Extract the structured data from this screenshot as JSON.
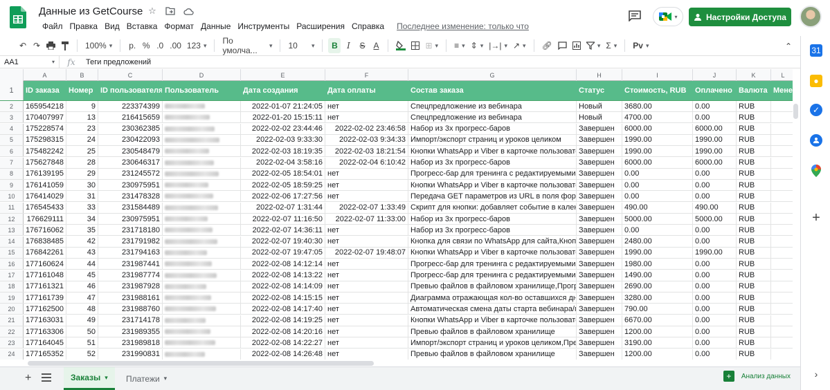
{
  "doc": {
    "title": "Данные из GetCourse",
    "last_edit": "Последнее изменение: только что"
  },
  "menu": [
    "Файл",
    "Правка",
    "Вид",
    "Вставка",
    "Формат",
    "Данные",
    "Инструменты",
    "Расширения",
    "Справка"
  ],
  "share_label": "Настройки Доступа",
  "toolbar": {
    "zoom": "100%",
    "currency": "р.",
    "percent": "%",
    "dec_less": ".0",
    "dec_more": ".00",
    "number_format": "123",
    "font": "По умолча...",
    "font_size": "10"
  },
  "formula": {
    "cell_ref": "AA1",
    "value": "Теги предложений"
  },
  "columns": [
    "A",
    "B",
    "C",
    "D",
    "E",
    "F",
    "G",
    "H",
    "I",
    "J",
    "K",
    "L"
  ],
  "headers": [
    "ID заказа",
    "Номер",
    "ID пользователя",
    "Пользователь",
    "Дата создания",
    "Дата оплаты",
    "Состав заказа",
    "Статус",
    "Стоимость, RUB",
    "Оплачено",
    "Валюта",
    "Менеджер"
  ],
  "rows": [
    {
      "n": "2",
      "id": "165954218",
      "num": "9",
      "uid": "223374399",
      "created": "2022-01-07 21:24:05",
      "paid": "нет",
      "comp": "Спецпредложение из вебинара",
      "status": "Новый",
      "cost": "3680.00",
      "paid_sum": "0.00",
      "cur": "RUB"
    },
    {
      "n": "3",
      "id": "170407997",
      "num": "13",
      "uid": "216415659",
      "created": "2022-01-20 15:15:11",
      "paid": "нет",
      "comp": "Спецпредложение из вебинара",
      "status": "Новый",
      "cost": "4700.00",
      "paid_sum": "0.00",
      "cur": "RUB"
    },
    {
      "n": "4",
      "id": "175228574",
      "num": "23",
      "uid": "230362385",
      "created": "2022-02-02 23:44:46",
      "paid": "2022-02-02 23:46:58",
      "comp": "Набор из 3х прогресс-баров",
      "status": "Завершен",
      "cost": "6000.00",
      "paid_sum": "6000.00",
      "cur": "RUB"
    },
    {
      "n": "5",
      "id": "175298315",
      "num": "24",
      "uid": "230422093",
      "created": "2022-02-03 9:33:30",
      "paid": "2022-02-03 9:34:33",
      "comp": "Импорт/экспорт страниц и уроков целиком",
      "status": "Завершен",
      "cost": "1990.00",
      "paid_sum": "1990.00",
      "cur": "RUB"
    },
    {
      "n": "6",
      "id": "175482242",
      "num": "25",
      "uid": "230548479",
      "created": "2022-02-03 18:19:35",
      "paid": "2022-02-03 18:21:54",
      "comp": "Кнопки WhatsApp и Viber в карточке пользователя",
      "status": "Завершен",
      "cost": "1990.00",
      "paid_sum": "1990.00",
      "cur": "RUB"
    },
    {
      "n": "7",
      "id": "175627848",
      "num": "28",
      "uid": "230646317",
      "created": "2022-02-04 3:58:16",
      "paid": "2022-02-04 6:10:42",
      "comp": "Набор из 3х прогресс-баров",
      "status": "Завершен",
      "cost": "6000.00",
      "paid_sum": "6000.00",
      "cur": "RUB"
    },
    {
      "n": "8",
      "id": "176139195",
      "num": "29",
      "uid": "231245572",
      "created": "2022-02-05 18:54:01",
      "paid": "нет",
      "comp": "Прогресс-бар для тренинга с редактируемыми эта",
      "status": "Завершен",
      "cost": "0.00",
      "paid_sum": "0.00",
      "cur": "RUB"
    },
    {
      "n": "9",
      "id": "176141059",
      "num": "30",
      "uid": "230975951",
      "created": "2022-02-05 18:59:25",
      "paid": "нет",
      "comp": "Кнопки WhatsApp и Viber в карточке пользователя",
      "status": "Завершен",
      "cost": "0.00",
      "paid_sum": "0.00",
      "cur": "RUB"
    },
    {
      "n": "10",
      "id": "176414029",
      "num": "31",
      "uid": "231478328",
      "created": "2022-02-06 17:27:56",
      "paid": "нет",
      "comp": "Передача GET параметров из URL в поля формы",
      "status": "Завершен",
      "cost": "0.00",
      "paid_sum": "0.00",
      "cur": "RUB"
    },
    {
      "n": "11",
      "id": "176545433",
      "num": "33",
      "uid": "231584489",
      "created": "2022-02-07 1:31:44",
      "paid": "2022-02-07 1:33:49",
      "comp": "Скрипт для кнопки: добавляет событие в календа",
      "status": "Завершен",
      "cost": "490.00",
      "paid_sum": "490.00",
      "cur": "RUB"
    },
    {
      "n": "12",
      "id": "176629111",
      "num": "34",
      "uid": "230975951",
      "created": "2022-02-07 11:16:50",
      "paid": "2022-02-07 11:33:00",
      "comp": "Набор из 3х прогресс-баров",
      "status": "Завершен",
      "cost": "5000.00",
      "paid_sum": "5000.00",
      "cur": "RUB"
    },
    {
      "n": "13",
      "id": "176716062",
      "num": "35",
      "uid": "231718180",
      "created": "2022-02-07 14:36:11",
      "paid": "нет",
      "comp": "Набор из 3х прогресс-баров",
      "status": "Завершен",
      "cost": "0.00",
      "paid_sum": "0.00",
      "cur": "RUB"
    },
    {
      "n": "14",
      "id": "176838485",
      "num": "42",
      "uid": "231791982",
      "created": "2022-02-07 19:40:30",
      "paid": "нет",
      "comp": "Кнопка для связи по WhatsApp для сайта,Кнопки W",
      "status": "Завершен",
      "cost": "2480.00",
      "paid_sum": "0.00",
      "cur": "RUB"
    },
    {
      "n": "15",
      "id": "176842261",
      "num": "43",
      "uid": "231794163",
      "created": "2022-02-07 19:47:05",
      "paid": "2022-02-07 19:48:07",
      "comp": "Кнопки WhatsApp и Viber в карточке пользователя",
      "status": "Завершен",
      "cost": "1990.00",
      "paid_sum": "1990.00",
      "cur": "RUB"
    },
    {
      "n": "16",
      "id": "177160624",
      "num": "44",
      "uid": "231987441",
      "created": "2022-02-08 14:12:14",
      "paid": "нет",
      "comp": "Прогресс-бар для тренинга с редактируемыми эта",
      "status": "Завершен",
      "cost": "1980.00",
      "paid_sum": "0.00",
      "cur": "RUB"
    },
    {
      "n": "17",
      "id": "177161048",
      "num": "45",
      "uid": "231987774",
      "created": "2022-02-08 14:13:22",
      "paid": "нет",
      "comp": "Прогресс-бар для тренинга с редактируемыми эта",
      "status": "Завершен",
      "cost": "1490.00",
      "paid_sum": "0.00",
      "cur": "RUB"
    },
    {
      "n": "18",
      "id": "177161321",
      "num": "46",
      "uid": "231987928",
      "created": "2022-02-08 14:14:09",
      "paid": "нет",
      "comp": "Превью файлов в файловом хранилище,Прогресс",
      "status": "Завершен",
      "cost": "2690.00",
      "paid_sum": "0.00",
      "cur": "RUB"
    },
    {
      "n": "19",
      "id": "177161739",
      "num": "47",
      "uid": "231988161",
      "created": "2022-02-08 14:15:15",
      "paid": "нет",
      "comp": "Диаграмма отражающая кол-во оставшихся дней",
      "status": "Завершен",
      "cost": "3280.00",
      "paid_sum": "0.00",
      "cur": "RUB"
    },
    {
      "n": "20",
      "id": "177162500",
      "num": "48",
      "uid": "231988760",
      "created": "2022-02-08 14:17:40",
      "paid": "нет",
      "comp": "Автоматическая смена даты старта вебинара/пото",
      "status": "Завершен",
      "cost": "790.00",
      "paid_sum": "0.00",
      "cur": "RUB"
    },
    {
      "n": "21",
      "id": "177163031",
      "num": "49",
      "uid": "231714178",
      "created": "2022-02-08 14:19:25",
      "paid": "нет",
      "comp": "Кнопки WhatsApp и Viber в карточке пользователя",
      "status": "Завершен",
      "cost": "6670.00",
      "paid_sum": "0.00",
      "cur": "RUB"
    },
    {
      "n": "22",
      "id": "177163306",
      "num": "50",
      "uid": "231989355",
      "created": "2022-02-08 14:20:16",
      "paid": "нет",
      "comp": "Превью файлов в файловом хранилище",
      "status": "Завершен",
      "cost": "1200.00",
      "paid_sum": "0.00",
      "cur": "RUB"
    },
    {
      "n": "23",
      "id": "177164045",
      "num": "51",
      "uid": "231989818",
      "created": "2022-02-08 14:22:27",
      "paid": "нет",
      "comp": "Импорт/экспорт страниц и уроков целиком,Превью",
      "status": "Завершен",
      "cost": "3190.00",
      "paid_sum": "0.00",
      "cur": "RUB"
    },
    {
      "n": "24",
      "id": "177165352",
      "num": "52",
      "uid": "231990831",
      "created": "2022-02-08 14:26:48",
      "paid": "нет",
      "comp": "Превью файлов в файловом хранилище",
      "status": "Завершен",
      "cost": "1200.00",
      "paid_sum": "0.00",
      "cur": "RUB"
    }
  ],
  "header_row_number": "1",
  "sheets": [
    {
      "label": "Заказы",
      "active": true
    },
    {
      "label": "Платежи",
      "active": false
    }
  ],
  "explore_label": "Анализ данных",
  "accent": "#1e8e3e",
  "header_color": "#57bb8a"
}
